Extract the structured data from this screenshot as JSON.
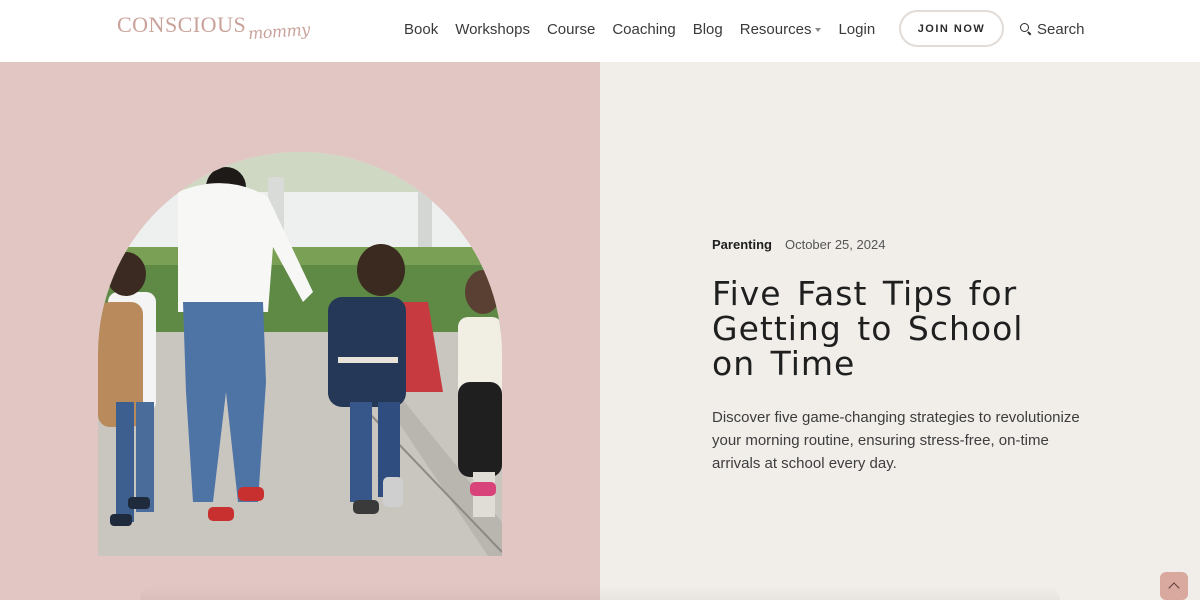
{
  "header": {
    "logo_main": "CONSCIOUS",
    "logo_script": "mommy",
    "nav": [
      {
        "label": "Book"
      },
      {
        "label": "Workshops"
      },
      {
        "label": "Course"
      },
      {
        "label": "Coaching"
      },
      {
        "label": "Blog"
      },
      {
        "label": "Resources",
        "has_dropdown": true
      },
      {
        "label": "Login"
      }
    ],
    "join_label": "JOIN NOW",
    "search_label": "Search"
  },
  "hero": {
    "category": "Parenting",
    "date": "October 25, 2024",
    "title": "Five Fast Tips for Getting to School on Time",
    "excerpt": "Discover five game-changing strategies to revolutionize your morning routine, ensuring stress-free, on-time arrivals at school every day."
  },
  "colors": {
    "left_panel": "#e2c6c3",
    "right_panel": "#f1eeea",
    "logo": "#c9a29a",
    "scroll_button": "#d9a9a0"
  },
  "icons": {
    "search": "search-icon",
    "scroll_top": "chevron-up-icon",
    "dropdown": "caret-down-icon"
  }
}
